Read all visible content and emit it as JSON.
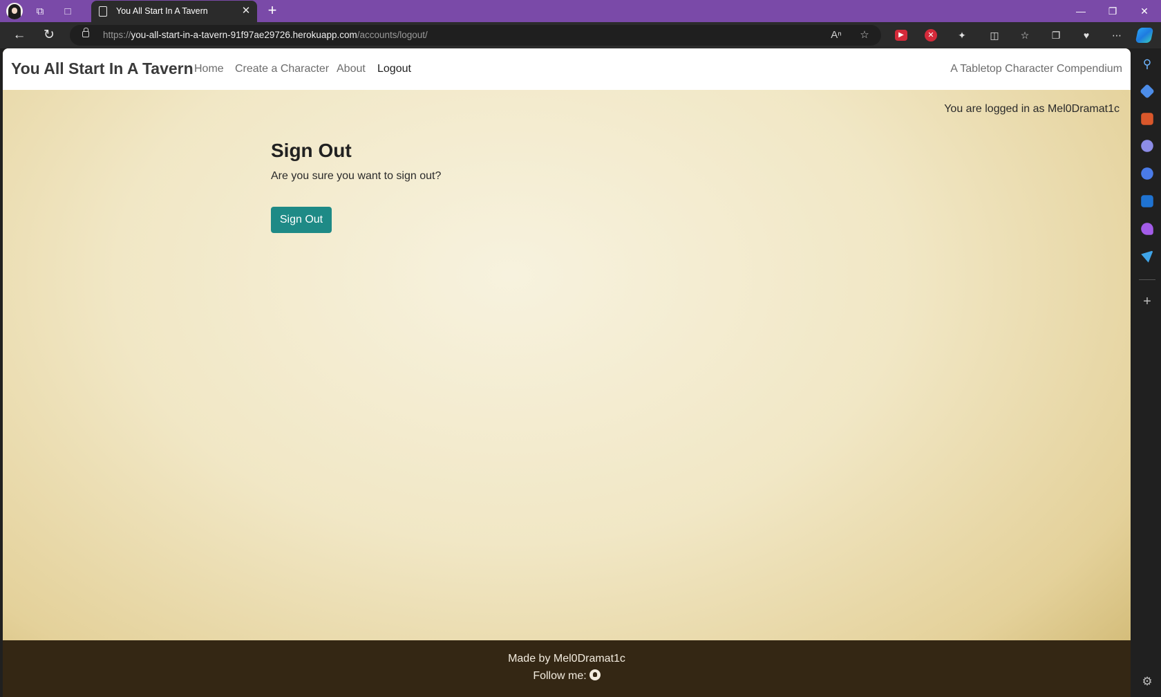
{
  "browser": {
    "tab_title": "You All Start In A Tavern",
    "url_prefix": "https://",
    "url_host": "you-all-start-in-a-tavern-91f97ae29726.herokuapp.com",
    "url_path": "/accounts/logout/",
    "icons": {
      "back": "back-arrow-icon",
      "refresh": "refresh-icon",
      "read_aloud": "read-aloud-icon",
      "favorite": "star-icon",
      "settings": "more-icon"
    }
  },
  "site": {
    "brand": "You All Start In A Tavern",
    "nav": [
      {
        "label": "Home",
        "active": false
      },
      {
        "label": "Create a Character",
        "active": false
      },
      {
        "label": "About",
        "active": false
      },
      {
        "label": "Logout",
        "active": true
      }
    ],
    "tagline": "A Tabletop Character Compendium",
    "logged_in_text": "You are logged in as Mel0Dramat1c"
  },
  "main": {
    "heading": "Sign Out",
    "question": "Are you sure you want to sign out?",
    "button_label": "Sign Out",
    "button_color": "#1e8a86"
  },
  "footer": {
    "made_by": "Made by Mel0Dramat1c",
    "follow": "Follow me:",
    "follow_icon": "github-icon",
    "background": "#342714"
  },
  "colors": {
    "titlebar": "#7a4aa8",
    "toolbar": "#2b2b2b",
    "page_background": "#f1e7c5"
  }
}
